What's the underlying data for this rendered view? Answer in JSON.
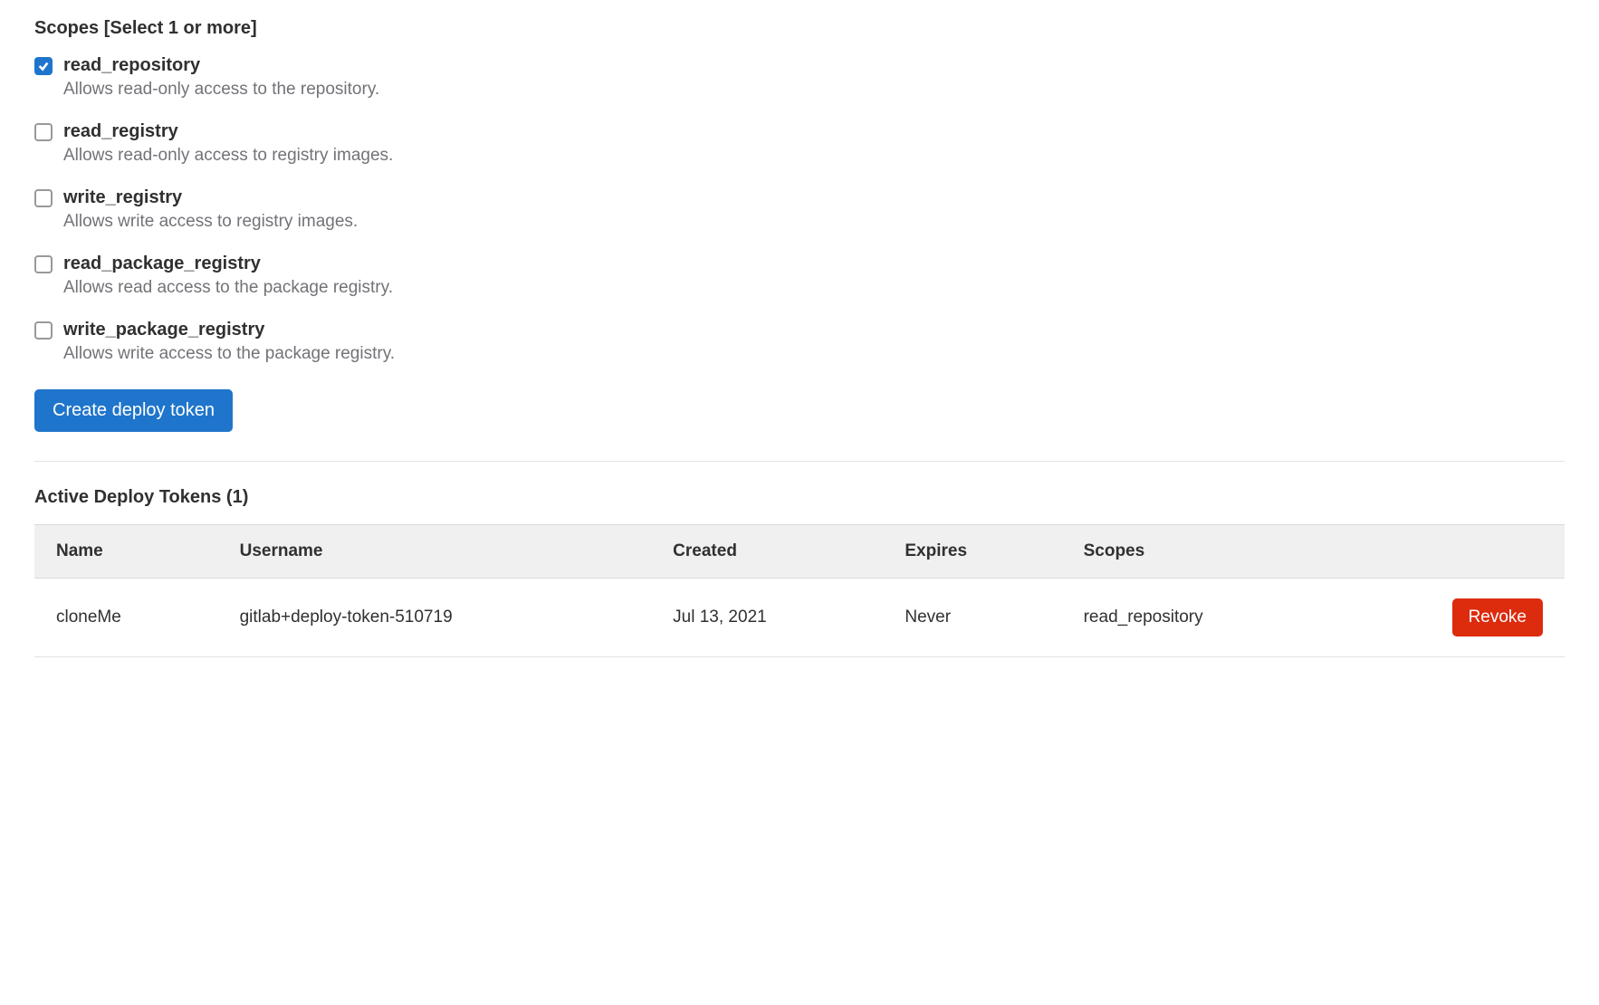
{
  "scopes_title": "Scopes [Select 1 or more]",
  "scopes": [
    {
      "label": "read_repository",
      "desc": "Allows read-only access to the repository.",
      "checked": true
    },
    {
      "label": "read_registry",
      "desc": "Allows read-only access to registry images.",
      "checked": false
    },
    {
      "label": "write_registry",
      "desc": "Allows write access to registry images.",
      "checked": false
    },
    {
      "label": "read_package_registry",
      "desc": "Allows read access to the package registry.",
      "checked": false
    },
    {
      "label": "write_package_registry",
      "desc": "Allows write access to the package registry.",
      "checked": false
    }
  ],
  "create_button": "Create deploy token",
  "active_tokens_title": "Active Deploy Tokens (1)",
  "table_headers": {
    "name": "Name",
    "username": "Username",
    "created": "Created",
    "expires": "Expires",
    "scopes": "Scopes"
  },
  "tokens": [
    {
      "name": "cloneMe",
      "username": "gitlab+deploy-token-510719",
      "created": "Jul 13, 2021",
      "expires": "Never",
      "scopes": "read_repository",
      "revoke": "Revoke"
    }
  ]
}
